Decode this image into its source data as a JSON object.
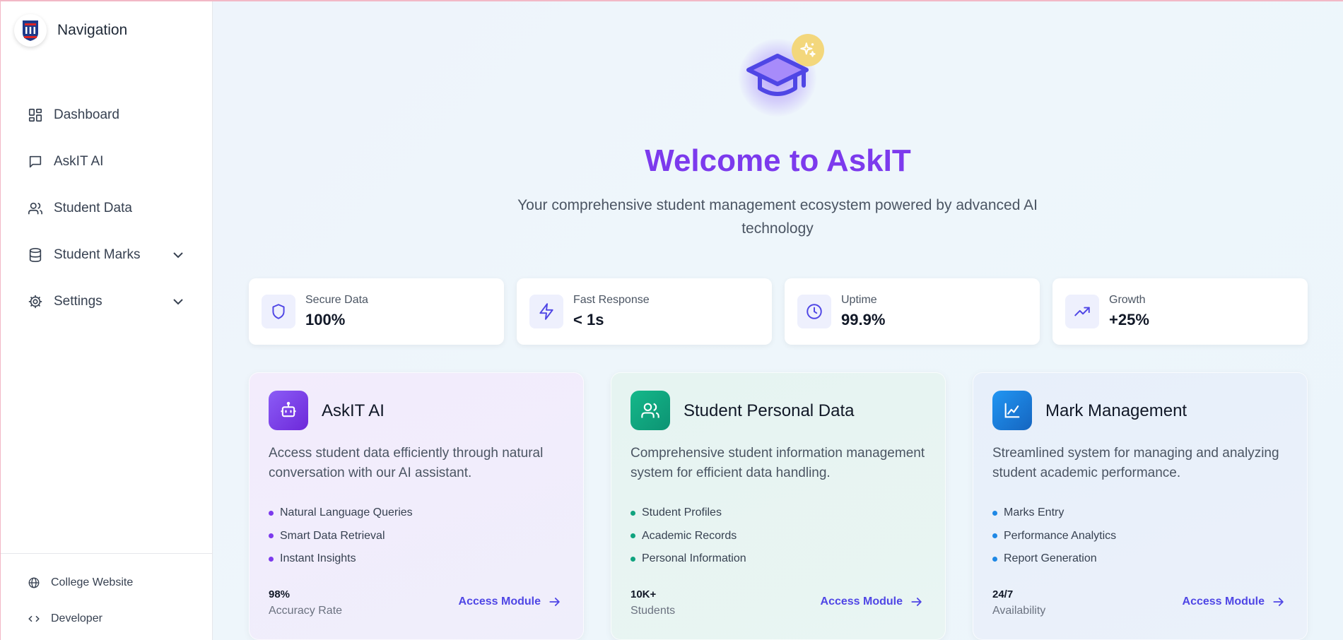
{
  "colors": {
    "accent": "#7c3aed",
    "indigo": "#4f46e5",
    "askit_icon": "#7c3aed",
    "student_icon": "#10a37f",
    "marks_icon": "#1e88e5"
  },
  "sidebar": {
    "title": "Navigation",
    "items": [
      {
        "label": "Dashboard",
        "icon": "dashboard-icon"
      },
      {
        "label": "AskIT AI",
        "icon": "chat-icon"
      },
      {
        "label": "Student Data",
        "icon": "users-icon"
      },
      {
        "label": "Student Marks",
        "icon": "database-icon",
        "expandable": true
      },
      {
        "label": "Settings",
        "icon": "gear-icon",
        "expandable": true
      }
    ],
    "bottom": [
      {
        "label": "College Website",
        "icon": "globe-icon"
      },
      {
        "label": "Developer",
        "icon": "code-icon"
      }
    ]
  },
  "hero": {
    "title": "Welcome to AskIT",
    "subtitle": "Your comprehensive student management ecosystem powered by advanced AI technology"
  },
  "stats": [
    {
      "label": "Secure Data",
      "value": "100%",
      "icon": "shield-icon"
    },
    {
      "label": "Fast Response",
      "value": "< 1s",
      "icon": "lightning-icon"
    },
    {
      "label": "Uptime",
      "value": "99.9%",
      "icon": "clock-icon"
    },
    {
      "label": "Growth",
      "value": "+25%",
      "icon": "trending-up-icon"
    }
  ],
  "cards": [
    {
      "title": "AskIT AI",
      "description": "Access student data efficiently through natural conversation with our AI assistant.",
      "features": [
        "Natural Language Queries",
        "Smart Data Retrieval",
        "Instant Insights"
      ],
      "metric_value": "98%",
      "metric_label": "Accuracy Rate",
      "action": "Access Module",
      "icon": "robot-icon"
    },
    {
      "title": "Student Personal Data",
      "description": "Comprehensive student information management system for efficient data handling.",
      "features": [
        "Student Profiles",
        "Academic Records",
        "Personal Information"
      ],
      "metric_value": "10K+",
      "metric_label": "Students",
      "action": "Access Module",
      "icon": "users-icon"
    },
    {
      "title": "Mark Management",
      "description": "Streamlined system for managing and analyzing student academic performance.",
      "features": [
        "Marks Entry",
        "Performance Analytics",
        "Report Generation"
      ],
      "metric_value": "24/7",
      "metric_label": "Availability",
      "action": "Access Module",
      "icon": "chart-icon"
    }
  ]
}
